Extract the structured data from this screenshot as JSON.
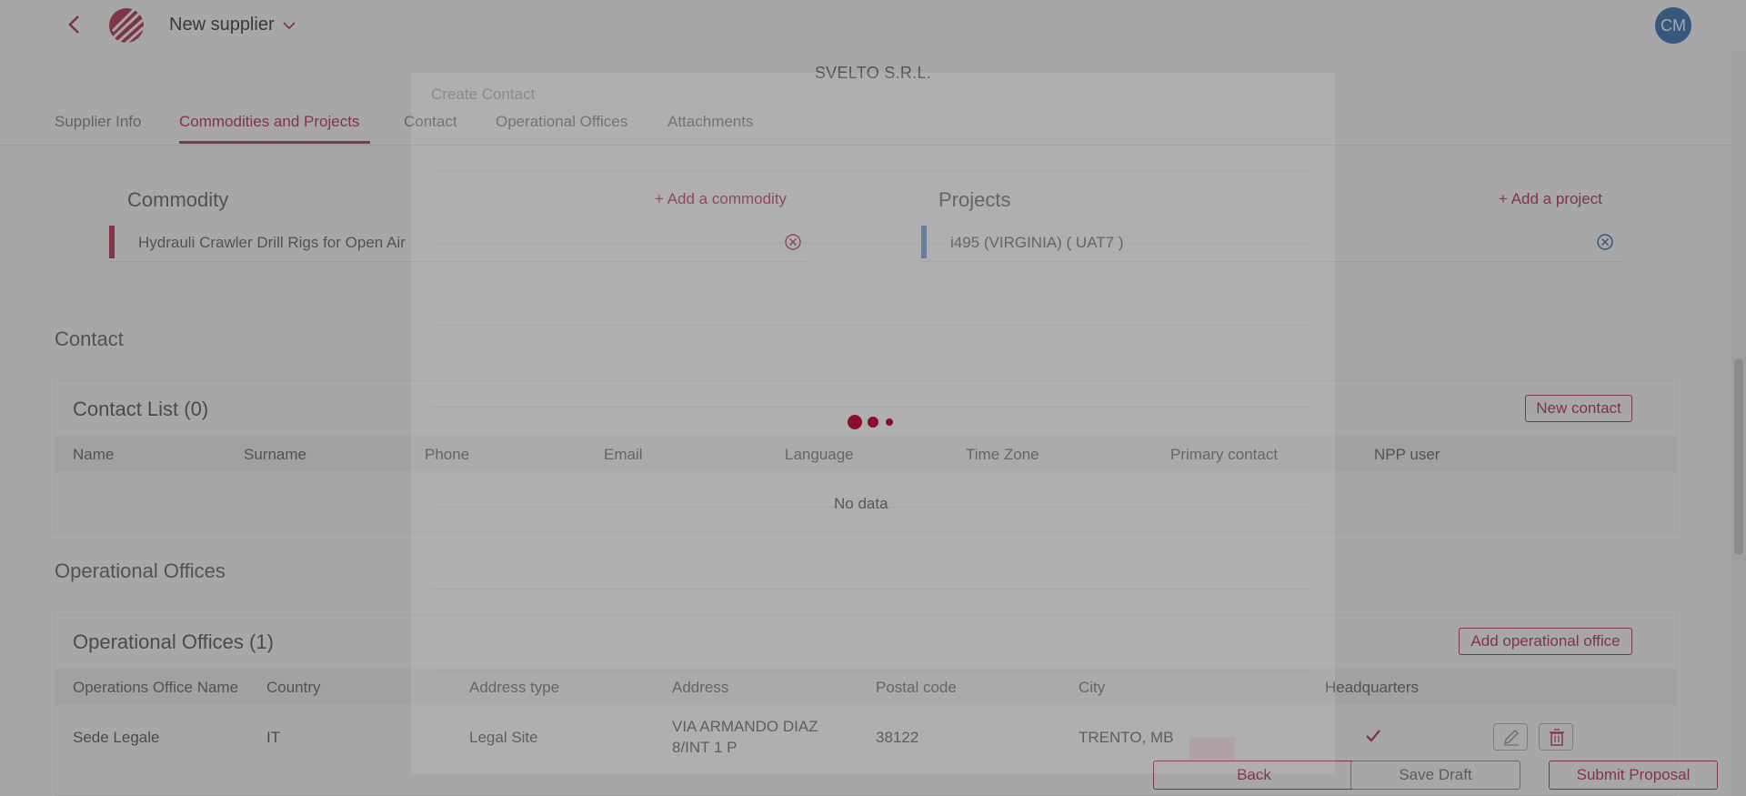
{
  "header": {
    "title": "New supplier",
    "avatar_initials": "CM"
  },
  "supplier": {
    "name": "SVELTO S.R.L."
  },
  "tabs": [
    {
      "label": "Supplier Info"
    },
    {
      "label": "Commodities and Projects"
    },
    {
      "label": "Contact"
    },
    {
      "label": "Operational Offices"
    },
    {
      "label": "Attachments"
    }
  ],
  "commodity": {
    "title": "Commodity",
    "add_label": "+ Add a commodity",
    "items": [
      "Hydrauli Crawler Drill Rigs for Open Air"
    ]
  },
  "projects": {
    "title": "Projects",
    "add_label": "+ Add a project",
    "items": [
      "i495 (VIRGINIA) ( UAT7 )"
    ]
  },
  "contact": {
    "section_title": "Contact",
    "list_title": "Contact List (0)",
    "new_button": "New contact",
    "columns": [
      "Name",
      "Surname",
      "Phone",
      "Email",
      "Language",
      "Time Zone",
      "Primary contact",
      "NPP user"
    ],
    "empty_text": "No data"
  },
  "offices": {
    "section_title": "Operational Offices",
    "list_title": "Operational Offices (1)",
    "add_button": "Add operational office",
    "columns": [
      "Operations Office Name",
      "Country",
      "Address type",
      "Address",
      "Postal code",
      "City",
      "Headquarters"
    ],
    "rows": [
      {
        "name": "Sede Legale",
        "country": "IT",
        "address_type": "Legal Site",
        "address_line1": "VIA ARMANDO DIAZ",
        "address_line2": "8/INT 1 P",
        "postal_code": "38122",
        "city": "TRENTO, MB",
        "headquarters": true
      }
    ]
  },
  "footer": {
    "back": "Back",
    "save_draft": "Save Draft",
    "submit": "Submit Proposal"
  },
  "modal": {
    "title": "Create Contact"
  },
  "colors": {
    "accent": "#b0193e",
    "project_bar": "#5b8fd6",
    "avatar": "#1f5fa8",
    "overlay": "rgba(80,80,80,0.5)"
  },
  "icons": {
    "back": "chevron-left-icon",
    "dropdown": "chevron-down-icon",
    "remove": "close-circle-icon",
    "edit": "pencil-icon",
    "delete": "trash-icon",
    "check": "check-icon"
  }
}
